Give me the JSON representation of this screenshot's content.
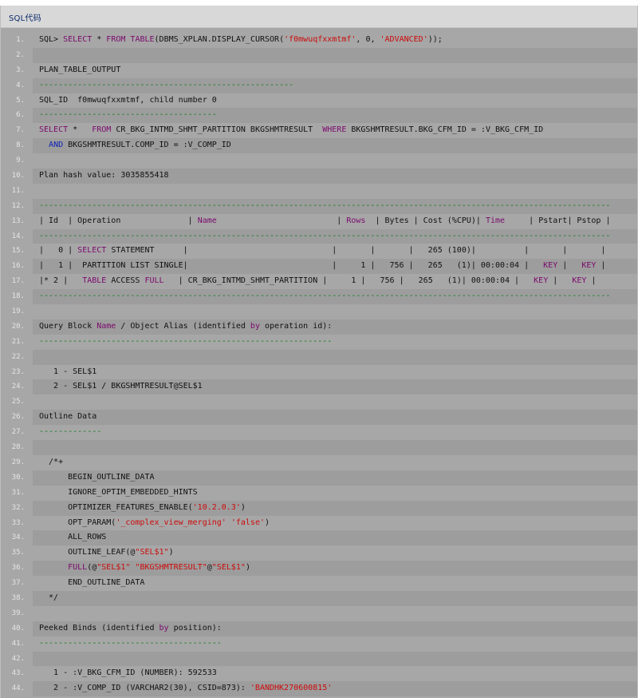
{
  "header": {
    "title": "SQL代码"
  },
  "code": {
    "lines": [
      {
        "n": "1.",
        "segs": [
          {
            "t": "SQL> "
          },
          {
            "t": "SELECT",
            "c": "kw"
          },
          {
            "t": " * "
          },
          {
            "t": "FROM",
            "c": "kw"
          },
          {
            "t": " "
          },
          {
            "t": "TABLE",
            "c": "kw"
          },
          {
            "t": "(DBMS_XPLAN.DISPLAY_CURSOR("
          },
          {
            "t": "'f0mwuqfxxmtmf'",
            "c": "str"
          },
          {
            "t": ", 0, "
          },
          {
            "t": "'ADVANCED'",
            "c": "str"
          },
          {
            "t": "));"
          }
        ]
      },
      {
        "n": "2.",
        "segs": []
      },
      {
        "n": "3.",
        "segs": [
          {
            "t": "PLAN_TABLE_OUTPUT"
          }
        ]
      },
      {
        "n": "4.",
        "segs": [
          {
            "t": "-----------------------------------------------------",
            "c": "dash"
          }
        ]
      },
      {
        "n": "5.",
        "segs": [
          {
            "t": "SQL_ID  f0mwuqfxxmtmf, child number 0"
          }
        ]
      },
      {
        "n": "6.",
        "segs": [
          {
            "t": "-------------------------------------",
            "c": "dash"
          }
        ]
      },
      {
        "n": "7.",
        "segs": [
          {
            "t": "SELECT",
            "c": "kw"
          },
          {
            "t": " *   "
          },
          {
            "t": "FROM",
            "c": "kw"
          },
          {
            "t": " CR_BKG_INTMD_SHMT_PARTITION BKGSHMTRESULT  "
          },
          {
            "t": "WHERE",
            "c": "kw"
          },
          {
            "t": " BKGSHMTRESULT.BKG_CFM_ID = :V_BKG_CFM_ID"
          }
        ]
      },
      {
        "n": "8.",
        "segs": [
          {
            "t": "  "
          },
          {
            "t": "AND",
            "c": "kwb"
          },
          {
            "t": " BKGSHMTRESULT.COMP_ID = :V_COMP_ID"
          }
        ]
      },
      {
        "n": "9.",
        "segs": []
      },
      {
        "n": "10.",
        "segs": [
          {
            "t": "Plan hash value: 3035855418"
          }
        ]
      },
      {
        "n": "11.",
        "segs": []
      },
      {
        "n": "12.",
        "segs": [
          {
            "t": "-----------------------------------------------------------------------------------------------------------------------",
            "c": "dash"
          }
        ]
      },
      {
        "n": "13.",
        "segs": [
          {
            "t": "| Id  | Operation              | "
          },
          {
            "t": "Name",
            "c": "kw"
          },
          {
            "t": "                         | "
          },
          {
            "t": "Rows",
            "c": "kw"
          },
          {
            "t": "  | Bytes | Cost (%CPU)| "
          },
          {
            "t": "Time",
            "c": "kw"
          },
          {
            "t": "     | Pstart| Pstop |"
          }
        ]
      },
      {
        "n": "14.",
        "segs": [
          {
            "t": "-----------------------------------------------------------------------------------------------------------------------",
            "c": "dash"
          }
        ]
      },
      {
        "n": "15.",
        "segs": [
          {
            "t": "|   0 | "
          },
          {
            "t": "SELECT",
            "c": "kw"
          },
          {
            "t": " STATEMENT      |                              |       |       |   265 (100)|          |       |       |"
          }
        ]
      },
      {
        "n": "16.",
        "segs": [
          {
            "t": "|   1 |  PARTITION LIST SINGLE|                              |     1 |   756 |   265   (1)| 00:00:04 |   "
          },
          {
            "t": "KEY",
            "c": "kw"
          },
          {
            "t": " |   "
          },
          {
            "t": "KEY",
            "c": "kw"
          },
          {
            "t": " |"
          }
        ]
      },
      {
        "n": "17.",
        "segs": [
          {
            "t": "|* 2 |   "
          },
          {
            "t": "TABLE",
            "c": "kw"
          },
          {
            "t": " ACCESS "
          },
          {
            "t": "FULL",
            "c": "kw"
          },
          {
            "t": "   | CR_BKG_INTMD_SHMT_PARTITION |     1 |   756 |   265   (1)| 00:00:04 |   "
          },
          {
            "t": "KEY",
            "c": "kw"
          },
          {
            "t": " |   "
          },
          {
            "t": "KEY",
            "c": "kw"
          },
          {
            "t": " |"
          }
        ]
      },
      {
        "n": "18.",
        "segs": [
          {
            "t": "-----------------------------------------------------------------------------------------------------------------------",
            "c": "dash"
          }
        ]
      },
      {
        "n": "19.",
        "segs": []
      },
      {
        "n": "20.",
        "segs": [
          {
            "t": "Query Block "
          },
          {
            "t": "Name",
            "c": "kw"
          },
          {
            "t": " / Object Alias (identified "
          },
          {
            "t": "by",
            "c": "kw"
          },
          {
            "t": " operation id):"
          }
        ]
      },
      {
        "n": "21.",
        "segs": [
          {
            "t": "-------------------------------------------------------------",
            "c": "dash"
          }
        ]
      },
      {
        "n": "22.",
        "segs": []
      },
      {
        "n": "23.",
        "segs": [
          {
            "t": "   1 - SEL$1"
          }
        ]
      },
      {
        "n": "24.",
        "segs": [
          {
            "t": "   2 - SEL$1 / BKGSHMTRESULT@SEL$1"
          }
        ]
      },
      {
        "n": "25.",
        "segs": []
      },
      {
        "n": "26.",
        "segs": [
          {
            "t": "Outline Data"
          }
        ]
      },
      {
        "n": "27.",
        "segs": [
          {
            "t": "-------------",
            "c": "dash"
          }
        ]
      },
      {
        "n": "28.",
        "segs": []
      },
      {
        "n": "29.",
        "segs": [
          {
            "t": "  /*+"
          }
        ]
      },
      {
        "n": "30.",
        "segs": [
          {
            "t": "      BEGIN_OUTLINE_DATA"
          }
        ]
      },
      {
        "n": "31.",
        "segs": [
          {
            "t": "      IGNORE_OPTIM_EMBEDDED_HINTS"
          }
        ]
      },
      {
        "n": "32.",
        "segs": [
          {
            "t": "      OPTIMIZER_FEATURES_ENABLE("
          },
          {
            "t": "'10.2.0.3'",
            "c": "str"
          },
          {
            "t": ")"
          }
        ]
      },
      {
        "n": "33.",
        "segs": [
          {
            "t": "      OPT_PARAM("
          },
          {
            "t": "'_complex_view_merging'",
            "c": "str"
          },
          {
            "t": " "
          },
          {
            "t": "'false'",
            "c": "str"
          },
          {
            "t": ")"
          }
        ]
      },
      {
        "n": "34.",
        "segs": [
          {
            "t": "      ALL_ROWS"
          }
        ]
      },
      {
        "n": "35.",
        "segs": [
          {
            "t": "      OUTLINE_LEAF(@"
          },
          {
            "t": "\"SEL$1\"",
            "c": "str"
          },
          {
            "t": ")"
          }
        ]
      },
      {
        "n": "36.",
        "segs": [
          {
            "t": "      "
          },
          {
            "t": "FULL",
            "c": "kw"
          },
          {
            "t": "(@"
          },
          {
            "t": "\"SEL$1\"",
            "c": "str"
          },
          {
            "t": " "
          },
          {
            "t": "\"BKGSHMTRESULT\"",
            "c": "str"
          },
          {
            "t": "@"
          },
          {
            "t": "\"SEL$1\"",
            "c": "str"
          },
          {
            "t": ")"
          }
        ]
      },
      {
        "n": "37.",
        "segs": [
          {
            "t": "      END_OUTLINE_DATA"
          }
        ]
      },
      {
        "n": "38.",
        "segs": [
          {
            "t": "  */"
          }
        ]
      },
      {
        "n": "39.",
        "segs": []
      },
      {
        "n": "40.",
        "segs": [
          {
            "t": "Peeked Binds (identified "
          },
          {
            "t": "by",
            "c": "kw"
          },
          {
            "t": " position):"
          }
        ]
      },
      {
        "n": "41.",
        "segs": [
          {
            "t": "--------------------------------------",
            "c": "dash"
          }
        ]
      },
      {
        "n": "42.",
        "segs": []
      },
      {
        "n": "43.",
        "segs": [
          {
            "t": "   1 - :V_BKG_CFM_ID (NUMBER): 592533"
          }
        ]
      },
      {
        "n": "44.",
        "segs": [
          {
            "t": "   2 - :V_COMP_ID (VARCHAR2(30), CSID=873): "
          },
          {
            "t": "'BANDHK270600815'",
            "c": "str"
          }
        ]
      }
    ]
  }
}
